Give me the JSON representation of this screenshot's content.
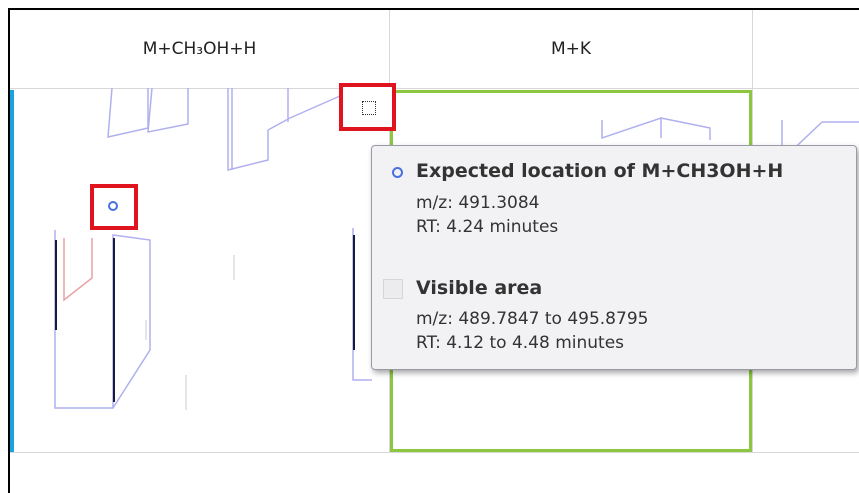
{
  "columns": [
    {
      "label": "M+CH₃OH+H"
    },
    {
      "label": "M+K"
    }
  ],
  "tooltip": {
    "expected": {
      "title": "Expected location of M+CH3OH+H",
      "mz": "m/z: 491.3084",
      "rt": "RT: 4.24 minutes"
    },
    "visible": {
      "title": "Visible area",
      "mz": "m/z: 489.7847 to 495.8795",
      "rt": "RT: 4.12 to 4.48 minutes"
    }
  },
  "colors": {
    "highlight": "#e0141e",
    "selected_column": "#8dc63f",
    "left_edge": "#1aa3e0",
    "peak_outline": "#b0b0ee",
    "expected_marker": "#4a6fe0"
  },
  "icons": [
    "expected-location-icon",
    "visible-area-icon"
  ]
}
